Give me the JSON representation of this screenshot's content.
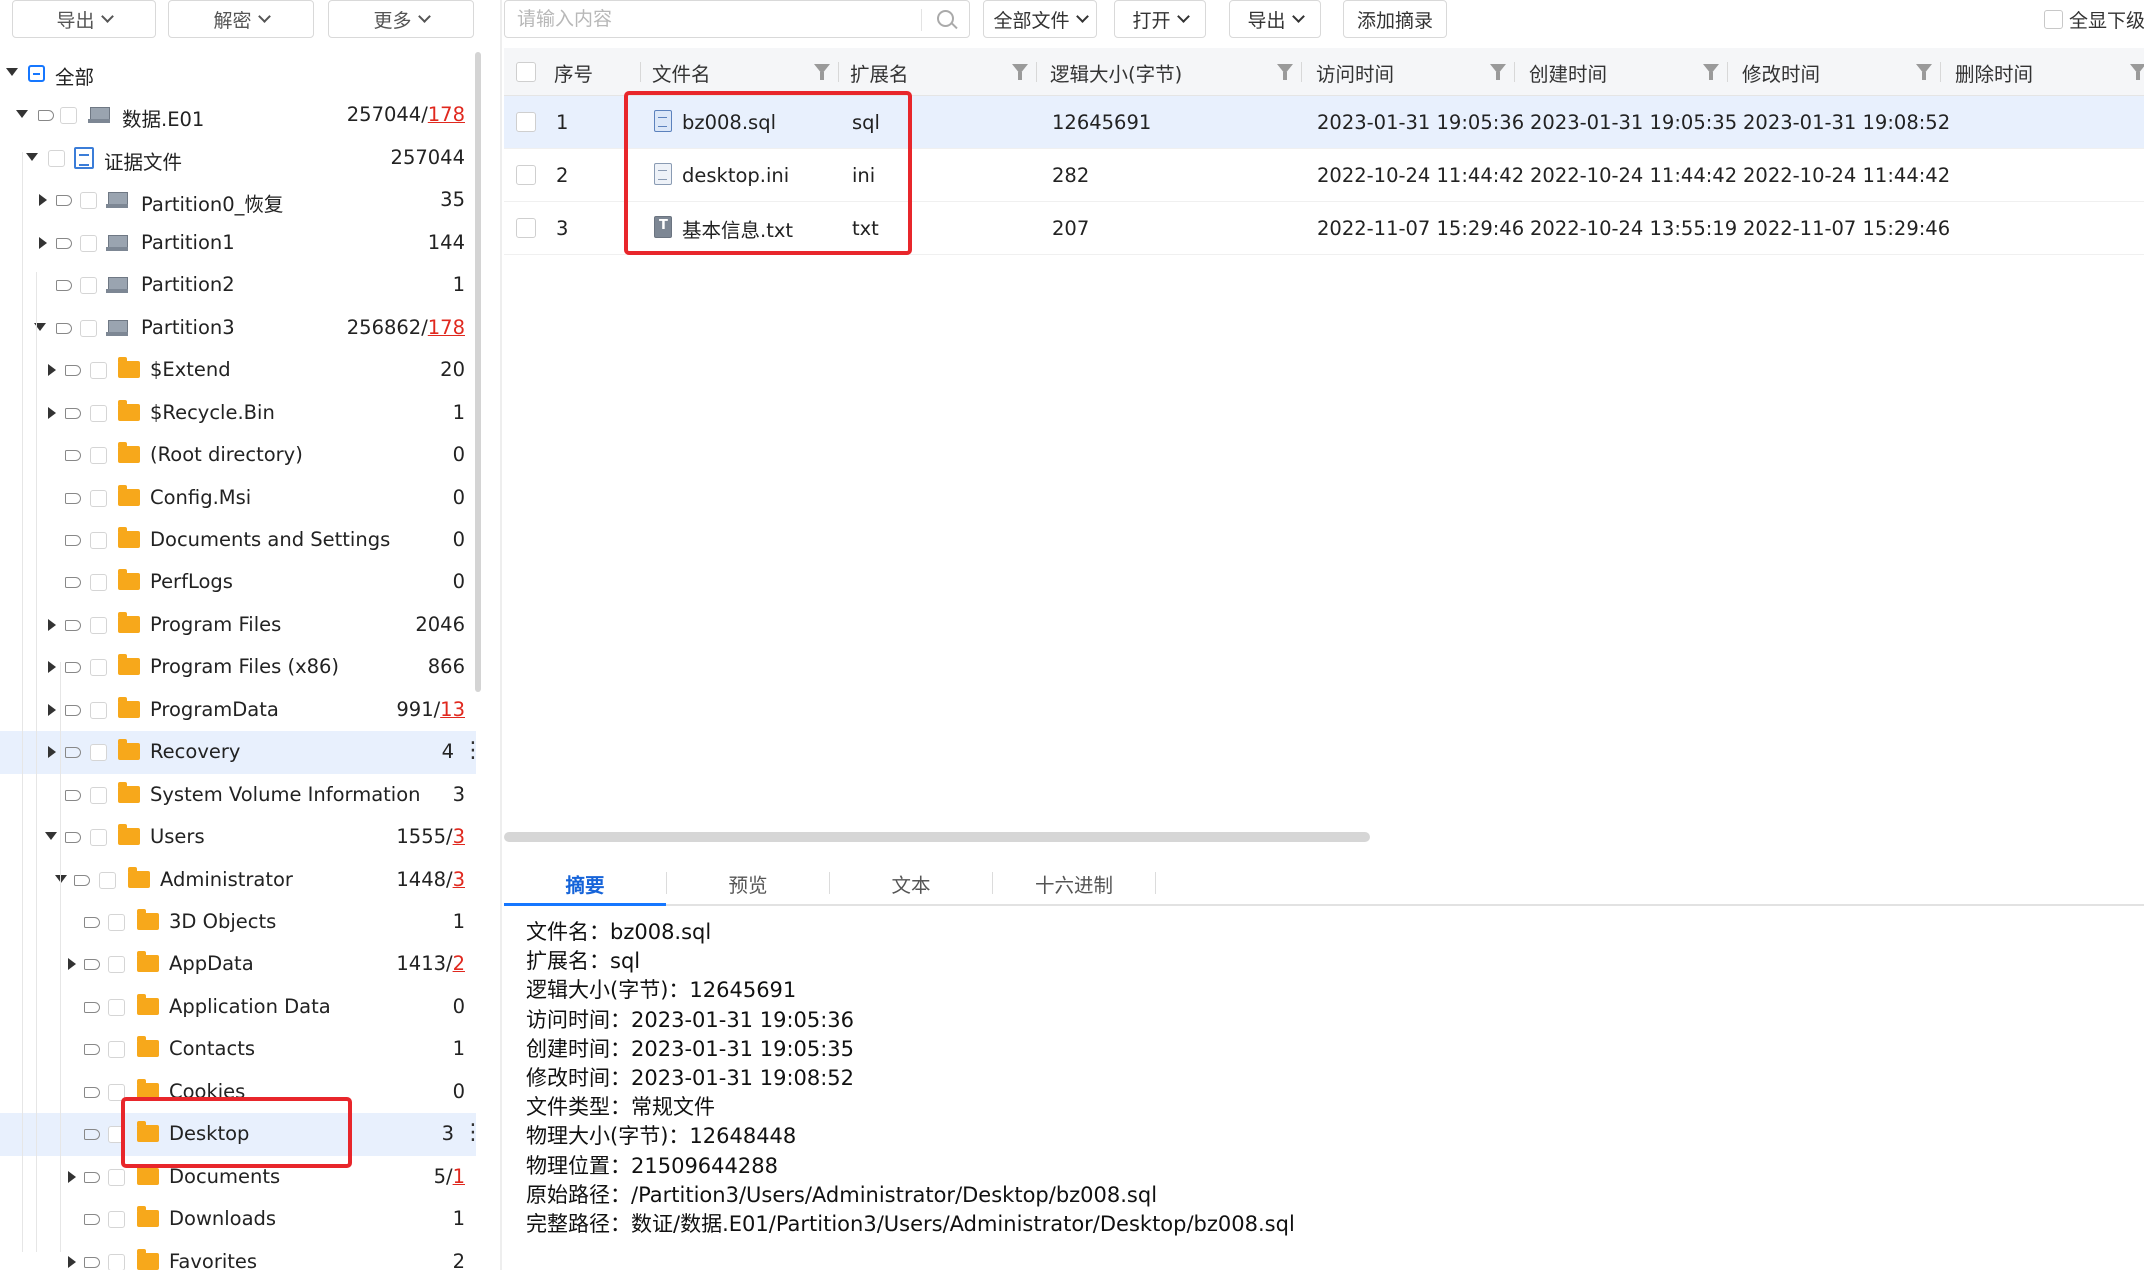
{
  "left_toolbar": {
    "export": "导出",
    "decrypt": "解密",
    "more": "更多"
  },
  "tree": [
    {
      "label": "全部",
      "count": "",
      "red": ""
    },
    {
      "label": "数据.E01",
      "count": "257044/",
      "red": "178"
    },
    {
      "label": "证据文件",
      "count": "257044",
      "red": ""
    },
    {
      "label": "Partition0_恢复",
      "count": "35",
      "red": ""
    },
    {
      "label": "Partition1",
      "count": "144",
      "red": ""
    },
    {
      "label": "Partition2",
      "count": "1",
      "red": ""
    },
    {
      "label": "Partition3",
      "count": "256862/",
      "red": "178"
    },
    {
      "label": "$Extend",
      "count": "20",
      "red": ""
    },
    {
      "label": "$Recycle.Bin",
      "count": "1",
      "red": ""
    },
    {
      "label": "(Root directory)",
      "count": "0",
      "red": ""
    },
    {
      "label": "Config.Msi",
      "count": "0",
      "red": ""
    },
    {
      "label": "Documents and Settings",
      "count": "0",
      "red": ""
    },
    {
      "label": "PerfLogs",
      "count": "0",
      "red": ""
    },
    {
      "label": "Program Files",
      "count": "2046",
      "red": ""
    },
    {
      "label": "Program Files (x86)",
      "count": "866",
      "red": ""
    },
    {
      "label": "ProgramData",
      "count": "991/",
      "red": "13"
    },
    {
      "label": "Recovery",
      "count": "4",
      "red": ""
    },
    {
      "label": "System Volume Information",
      "count": "3",
      "red": ""
    },
    {
      "label": "Users",
      "count": "1555/",
      "red": "3"
    },
    {
      "label": "Administrator",
      "count": "1448/",
      "red": "3"
    },
    {
      "label": "3D Objects",
      "count": "1",
      "red": ""
    },
    {
      "label": "AppData",
      "count": "1413/",
      "red": "2"
    },
    {
      "label": "Application Data",
      "count": "0",
      "red": ""
    },
    {
      "label": "Contacts",
      "count": "1",
      "red": ""
    },
    {
      "label": "Cookies",
      "count": "0",
      "red": ""
    },
    {
      "label": "Desktop",
      "count": "3",
      "red": ""
    },
    {
      "label": "Documents",
      "count": "5/",
      "red": "1"
    },
    {
      "label": "Downloads",
      "count": "1",
      "red": ""
    },
    {
      "label": "Favorites",
      "count": "2",
      "red": ""
    }
  ],
  "right_toolbar": {
    "search_placeholder": "请输入内容",
    "all_files": "全部文件",
    "open": "打开",
    "export": "导出",
    "add_digest": "添加摘录",
    "select_all_sub": "全显下级"
  },
  "grid": {
    "headers": {
      "index": "序号",
      "name": "文件名",
      "ext": "扩展名",
      "size": "逻辑大小(字节)",
      "accessed": "访问时间",
      "created": "创建时间",
      "modified": "修改时间",
      "deleted": "删除时间"
    },
    "rows": [
      {
        "index": "1",
        "name": "bz008.sql",
        "ext": "sql",
        "size": "12645691",
        "accessed": "2023-01-31 19:05:36",
        "created": "2023-01-31 19:05:35",
        "modified": "2023-01-31 19:08:52",
        "deleted": ""
      },
      {
        "index": "2",
        "name": "desktop.ini",
        "ext": "ini",
        "size": "282",
        "accessed": "2022-10-24 11:44:42",
        "created": "2022-10-24 11:44:42",
        "modified": "2022-10-24 11:44:42",
        "deleted": ""
      },
      {
        "index": "3",
        "name": "基本信息.txt",
        "ext": "txt",
        "size": "207",
        "accessed": "2022-11-07 15:29:46",
        "created": "2022-10-24 13:55:19",
        "modified": "2022-11-07 15:29:46",
        "deleted": ""
      }
    ]
  },
  "tabs": [
    "摘要",
    "预览",
    "文本",
    "十六进制"
  ],
  "summary": [
    "文件名：bz008.sql",
    "扩展名：sql",
    "逻辑大小(字节)：12645691",
    "访问时间：2023-01-31 19:05:36",
    "创建时间：2023-01-31 19:05:35",
    "修改时间：2023-01-31 19:08:52",
    "文件类型：常规文件",
    "物理大小(字节)：12648448",
    "物理位置：21509644288",
    "原始路径：/Partition3/Users/Administrator/Desktop/bz008.sql",
    "完整路径：数证/数据.E01/Partition3/Users/Administrator/Desktop/bz008.sql"
  ],
  "colors": {
    "accent": "#1677ff",
    "highlight": "#e8262b",
    "folder": "#f7a81b",
    "selected_row": "#e8f0fd"
  }
}
